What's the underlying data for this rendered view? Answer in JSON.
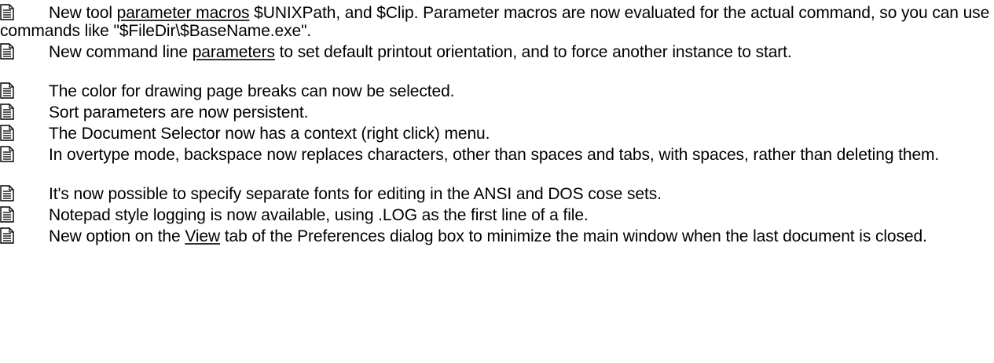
{
  "items": [
    {
      "before": "New tool ",
      "link": "parameter macros",
      "after": " $UNIXPath, and $Clip.   Parameter macros are now evaluated for the actual command, so you can use commands like \"$FileDir\\$BaseName.exe\"."
    },
    {
      "before": "New command line ",
      "link": "parameters",
      "after": " to set default printout orientation, and to force another instance to start."
    },
    {
      "text": "The color for drawing page breaks can now be selected."
    },
    {
      "text": "Sort parameters are now persistent."
    },
    {
      "text": "The Document Selector now has a context (right click) menu."
    },
    {
      "text": "In overtype mode, backspace now replaces characters, other than spaces and tabs, with spaces, rather than deleting them."
    },
    {
      "text": "It's now possible to specify separate fonts for editing in the ANSI and DOS cose sets."
    },
    {
      "text": "Notepad style logging is now available, using .LOG as the first line of a file."
    },
    {
      "before": "New option on the ",
      "link": "View",
      "after": " tab of the Preferences dialog box to minimize the main window when the last document is closed."
    }
  ]
}
